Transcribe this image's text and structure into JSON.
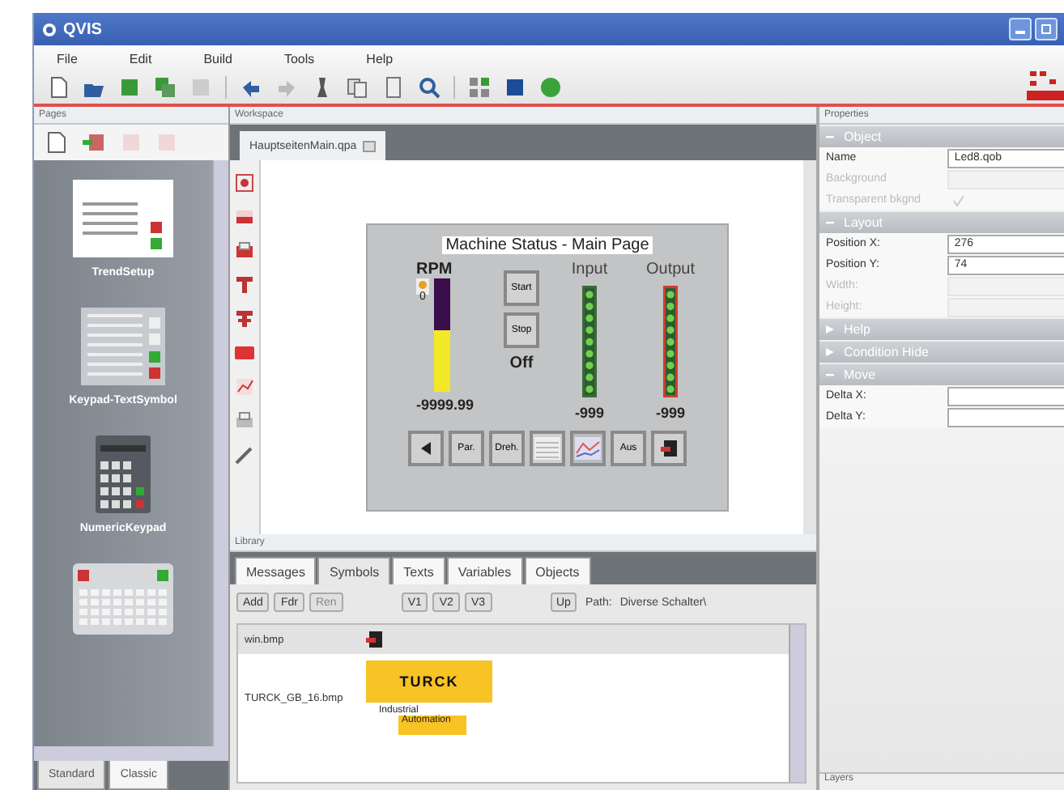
{
  "window": {
    "title": "QVIS"
  },
  "menu": [
    "File",
    "Edit",
    "Build",
    "Tools",
    "Help"
  ],
  "pages": {
    "title": "Pages",
    "items": [
      {
        "kind": "table",
        "label": "TrendSetup",
        "selected": false
      },
      {
        "kind": "list",
        "label": "Keypad-TextSymbol",
        "selected": false
      },
      {
        "kind": "keypad",
        "label": "NumericKeypad",
        "selected": false
      },
      {
        "kind": "keyboard",
        "selected": false
      }
    ],
    "tabs": [
      {
        "label": "Standard",
        "selected": true
      },
      {
        "label": "Classic",
        "selected": false
      }
    ]
  },
  "workspace": {
    "title": "Workspace",
    "tab": "HauptseitenMain.qpa",
    "canvas": {
      "title": "Machine Status - Main Page",
      "gauge_label": "RPM",
      "gauge_scale": "0",
      "level": 0.55,
      "gauge_value": "-9999.99",
      "buttons": [
        "Start",
        "Stop"
      ],
      "state": "Off",
      "leds": [
        {
          "label": "Input",
          "value": "-999",
          "selected": false
        },
        {
          "label": "Output",
          "value": "-999",
          "selected": true
        }
      ],
      "nav": [
        {
          "kind": "back",
          "selected": false
        },
        {
          "kind": "text",
          "label": "Par.",
          "selected": false
        },
        {
          "kind": "text",
          "label": "Dreh.",
          "selected": false
        },
        {
          "kind": "table",
          "selected": false
        },
        {
          "kind": "chart",
          "selected": true
        },
        {
          "kind": "text",
          "label": "Aus",
          "selected": false
        },
        {
          "kind": "exit",
          "selected": false
        }
      ]
    }
  },
  "library": {
    "title": "Library",
    "tabs": [
      {
        "label": "Messages",
        "selected": false
      },
      {
        "label": "Symbols",
        "selected": true
      },
      {
        "label": "Texts",
        "selected": false
      },
      {
        "label": "Variables",
        "selected": false
      },
      {
        "label": "Objects",
        "selected": false
      }
    ],
    "buttons": [
      {
        "label": "Add",
        "disabled": false
      },
      {
        "label": "Fdr",
        "disabled": false
      },
      {
        "label": "Ren",
        "disabled": true
      }
    ],
    "views": [
      "V1",
      "V2",
      "V3"
    ],
    "up": "Up",
    "path_label": "Path:",
    "path": "Diverse Schalter\\",
    "rows": [
      {
        "kind": "icon",
        "name": "win.bmp",
        "selected": true
      },
      {
        "kind": "logo",
        "name": "TURCK_GB_16.bmp",
        "logo": "TURCK",
        "caption": [
          "Industrial",
          "Automation"
        ],
        "selected": false
      }
    ]
  },
  "properties": {
    "title": "Properties",
    "sections": [
      {
        "title": "Object",
        "expanded": true,
        "rows": [
          {
            "kind": "field",
            "label": "Name",
            "value": "Led8.qob",
            "disabled": false
          },
          {
            "kind": "field",
            "label": "Background",
            "disabled": true
          },
          {
            "kind": "checkbox",
            "label": "Transparent bkgnd",
            "checked": true,
            "disabled": true
          }
        ]
      },
      {
        "title": "Layout",
        "expanded": true,
        "rows": [
          {
            "kind": "field",
            "label": "Position X:",
            "value": "276",
            "disabled": false
          },
          {
            "kind": "field",
            "label": "Position Y:",
            "value": "74",
            "disabled": false
          },
          {
            "kind": "field",
            "label": "Width:",
            "disabled": true
          },
          {
            "kind": "field",
            "label": "Height:",
            "disabled": true
          }
        ]
      },
      {
        "title": "Help",
        "expanded": false
      },
      {
        "title": "Condition Hide",
        "expanded": false
      },
      {
        "title": "Move",
        "expanded": true,
        "rows": [
          {
            "kind": "field",
            "label": "Delta X:",
            "disabled": false
          },
          {
            "kind": "field",
            "label": "Delta Y:",
            "disabled": false
          }
        ]
      }
    ],
    "footer": "Layers"
  }
}
